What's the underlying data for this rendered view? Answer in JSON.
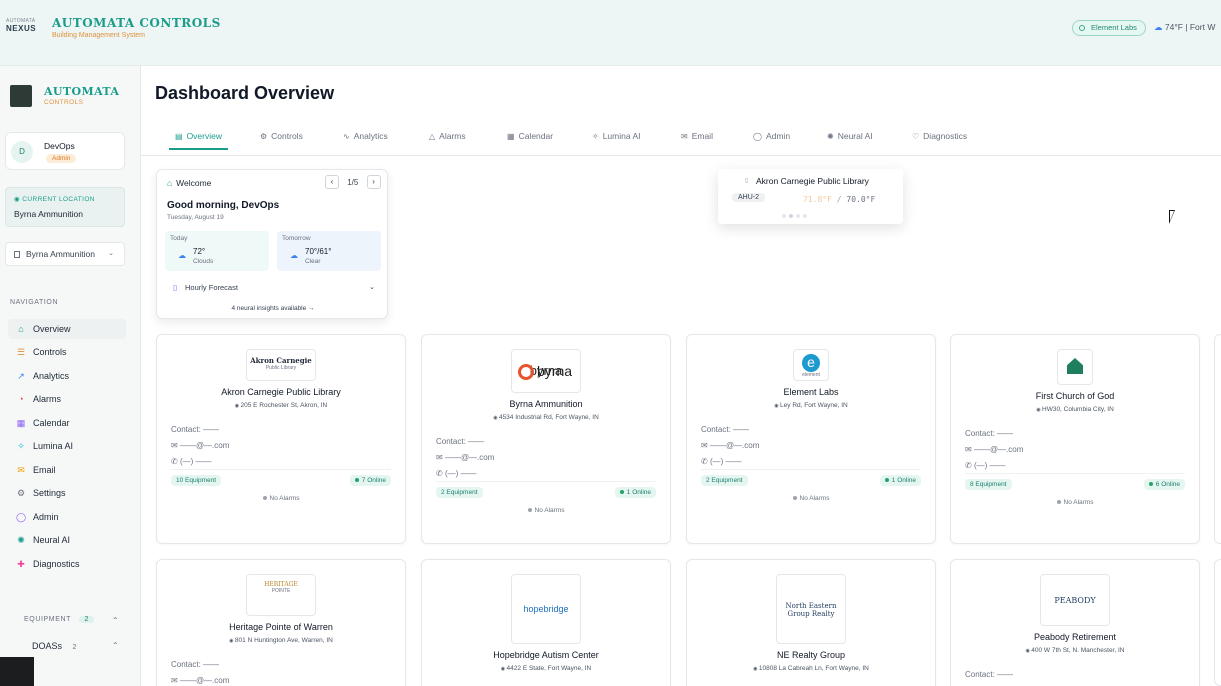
{
  "header": {
    "brand_small_top": "AUTOMATA",
    "brand_small_name": "NEXUS",
    "brand_title": "AUTOMATA CONTROLS",
    "brand_subtitle": "Building Management System",
    "location_pill": "Element Labs",
    "weather": "74°F | Fort W"
  },
  "sidebar": {
    "brand_title": "AUTOMATA",
    "brand_subtitle": "CONTROLS",
    "user": {
      "initial": "D",
      "name": "DevOps",
      "role": "Admin"
    },
    "current_location_label": "CURRENT LOCATION",
    "current_location_value": "Byrna Ammunition",
    "site_select_value": "Byrna Ammunition",
    "nav_heading": "NAVIGATION",
    "items": [
      {
        "label": "Overview",
        "icon": "home-icon",
        "glyph": "⌂",
        "color": "#1a9c8a"
      },
      {
        "label": "Controls",
        "icon": "sliders-icon",
        "glyph": "☰",
        "color": "#e0913b"
      },
      {
        "label": "Analytics",
        "icon": "trend-icon",
        "glyph": "↗",
        "color": "#3b82f6"
      },
      {
        "label": "Alarms",
        "icon": "bell-icon",
        "glyph": "◔",
        "color": "#ef4444"
      },
      {
        "label": "Calendar",
        "icon": "calendar-icon",
        "glyph": "▦",
        "color": "#8b5cf6"
      },
      {
        "label": "Lumina AI",
        "icon": "sparkle-icon",
        "glyph": "✧",
        "color": "#06b6d4"
      },
      {
        "label": "Email",
        "icon": "mail-icon",
        "glyph": "✉",
        "color": "#f59e0b"
      },
      {
        "label": "Settings",
        "icon": "gear-icon",
        "glyph": "⚙",
        "color": "#6b7280"
      },
      {
        "label": "Admin",
        "icon": "shield-icon",
        "glyph": "◯",
        "color": "#8b5cf6"
      },
      {
        "label": "Neural AI",
        "icon": "brain-icon",
        "glyph": "✺",
        "color": "#1a9c8a"
      },
      {
        "label": "Diagnostics",
        "icon": "stethoscope-icon",
        "glyph": "✚",
        "color": "#ec4899"
      }
    ],
    "equipment_heading": "EQUIPMENT",
    "equipment_count": "2",
    "doas_label": "DOASs",
    "doas_count": "2"
  },
  "main": {
    "title": "Dashboard Overview",
    "tabs": [
      {
        "label": "Overview",
        "glyph": "▤"
      },
      {
        "label": "Controls",
        "glyph": "⚙"
      },
      {
        "label": "Analytics",
        "glyph": "∿"
      },
      {
        "label": "Alarms",
        "glyph": "△"
      },
      {
        "label": "Calendar",
        "glyph": "▦"
      },
      {
        "label": "Lumina AI",
        "glyph": "✧"
      },
      {
        "label": "Email",
        "glyph": "✉"
      },
      {
        "label": "Admin",
        "glyph": "◯"
      },
      {
        "label": "Neural AI",
        "glyph": "✺"
      },
      {
        "label": "Diagnostics",
        "glyph": "♡"
      }
    ]
  },
  "welcome": {
    "heading": "Welcome",
    "pager": "1/5",
    "greeting": "Good morning, DevOps",
    "date": "Tuesday, August 19",
    "today_label": "Today",
    "today_temp": "72°",
    "today_cond": "Clouds",
    "tomorrow_label": "Tomorrow",
    "tomorrow_temp": "70°/61°",
    "tomorrow_cond": "Clear",
    "hourly": "Hourly Forecast",
    "insights": "4 neural insights available →"
  },
  "ahu_widget": {
    "title": "Akron Carnegie Public Library",
    "tag": "AHU-2",
    "temp_actual": "71.8°F",
    "temp_sep": "/",
    "temp_setpoint": "70.0°F"
  },
  "cards": [
    {
      "name": "Akron Carnegie Public Library",
      "address": "205 E Rochester St, Akron, IN",
      "contact": "Contact: ——",
      "email": "——@—.com",
      "phone": "(—) ——",
      "equipment": "10 Equipment",
      "online": "7 Online",
      "alarms": "No Alarms",
      "logo_text": "Akron Carnegie",
      "logo_sub": "Public Library"
    },
    {
      "name": "Byrna Ammunition",
      "address": "4534 Industrial Rd, Fort Wayne, IN",
      "contact": "Contact: ——",
      "email": "——@—.com",
      "phone": "(—) ——",
      "equipment": "2 Equipment",
      "online": "1 Online",
      "alarms": "No Alarms",
      "logo_text": "byrna",
      "logo_sub": ""
    },
    {
      "name": "Element Labs",
      "address": "Ley Rd, Fort Wayne, IN",
      "contact": "Contact: ——",
      "email": "——@—.com",
      "phone": "(—) ——",
      "equipment": "2 Equipment",
      "online": "1 Online",
      "alarms": "No Alarms",
      "logo_text": "e",
      "logo_sub": "element"
    },
    {
      "name": "First Church of God",
      "address": "HW30, Columbia City, IN",
      "contact": "Contact: ——",
      "email": "——@—.com",
      "phone": "(—) ——",
      "equipment": "8 Equipment",
      "online": "6 Online",
      "alarms": "No Alarms",
      "logo_text": "",
      "logo_sub": ""
    },
    {
      "name": "Heritage Pointe of Warren",
      "address": "801 N Huntington Ave, Warren, IN",
      "contact": "Contact: ——",
      "email": "——@—.com",
      "logo_text": "HERITAGE",
      "logo_sub": "POINTE"
    },
    {
      "name": "Hopebridge Autism Center",
      "address": "4422 E State, Fort Wayne, IN",
      "logo_text": "hopebridge",
      "logo_sub": ""
    },
    {
      "name": "NE Realty Group",
      "address": "10808 La Cabreah Ln, Fort Wayne, IN",
      "logo_text": "North Eastern",
      "logo_sub": "Group Realty"
    },
    {
      "name": "Peabody Retirement",
      "address": "400 W 7th St, N. Manchester, IN",
      "contact": "Contact: ——",
      "logo_text": "PEABODY",
      "logo_sub": ""
    }
  ]
}
